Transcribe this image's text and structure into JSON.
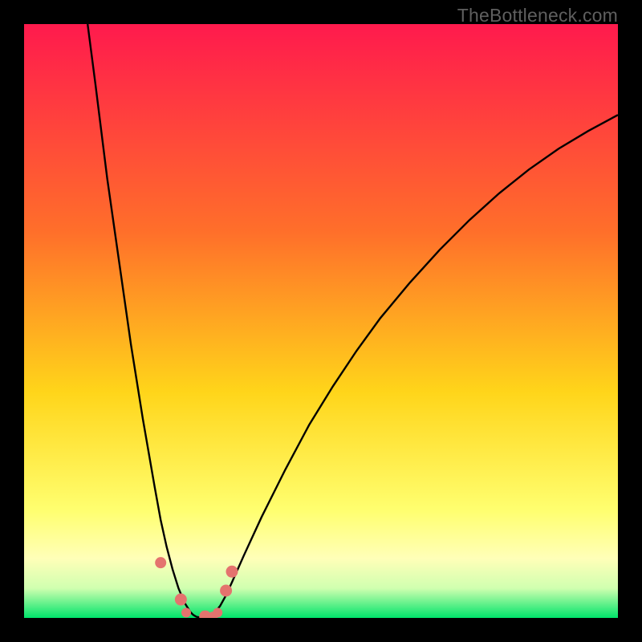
{
  "watermark": "TheBottleneck.com",
  "colors": {
    "gradient_top": "#ff1a4d",
    "gradient_mid1": "#ff6f2a",
    "gradient_mid2": "#ffd51a",
    "gradient_mid3": "#ffff70",
    "gradient_mid4": "#ffffb8",
    "gradient_mid5": "#d0ffb0",
    "gradient_bottom": "#00e46a",
    "curve": "#000000",
    "marker": "#e4736e"
  },
  "chart_data": {
    "type": "line",
    "title": "",
    "xlabel": "",
    "ylabel": "",
    "xlim": [
      0,
      100
    ],
    "ylim": [
      0,
      100
    ],
    "series": [
      {
        "name": "bottleneck-curve-left",
        "x": [
          10.7,
          12,
          14,
          16,
          18,
          20,
          22,
          23,
          24,
          25,
          26,
          27,
          28,
          28.5,
          29,
          30
        ],
        "y": [
          100,
          90,
          74,
          60,
          46,
          33.5,
          22,
          16.5,
          12,
          8.2,
          5,
          2.6,
          1.0,
          0.5,
          0.2,
          0
        ]
      },
      {
        "name": "bottleneck-curve-right",
        "x": [
          30,
          31,
          32,
          33,
          34,
          35,
          37,
          40,
          44,
          48,
          52,
          56,
          60,
          65,
          70,
          75,
          80,
          85,
          90,
          95,
          100
        ],
        "y": [
          0,
          0.2,
          0.8,
          2.0,
          3.8,
          6.0,
          10.5,
          17,
          25,
          32.5,
          39,
          45,
          50.5,
          56.5,
          62,
          67,
          71.5,
          75.5,
          79,
          82,
          84.7
        ]
      }
    ],
    "markers": [
      {
        "x": 23.0,
        "y": 9.3,
        "r": 7.0
      },
      {
        "x": 26.4,
        "y": 3.1,
        "r": 7.5
      },
      {
        "x": 27.3,
        "y": 0.9,
        "r": 6.0
      },
      {
        "x": 30.5,
        "y": 0.25,
        "r": 7.5
      },
      {
        "x": 31.8,
        "y": 0.25,
        "r": 6.0
      },
      {
        "x": 32.6,
        "y": 0.9,
        "r": 6.0
      },
      {
        "x": 34.0,
        "y": 4.6,
        "r": 7.5
      },
      {
        "x": 35.0,
        "y": 7.8,
        "r": 7.5
      }
    ]
  }
}
